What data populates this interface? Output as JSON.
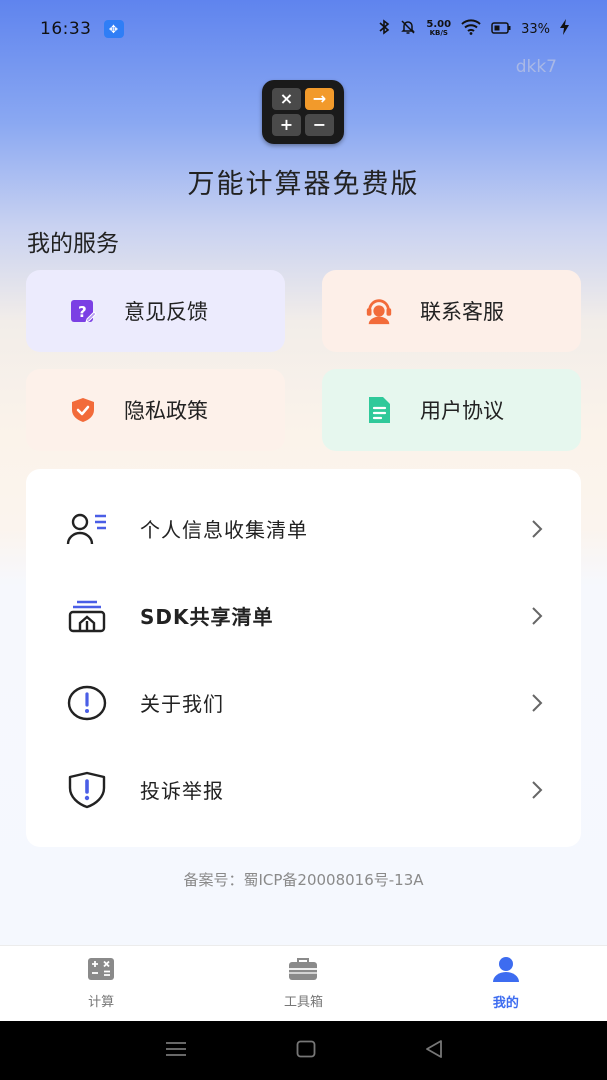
{
  "status_bar": {
    "time": "16:33",
    "speed_value": "5.00",
    "speed_unit": "KB/S",
    "battery": "33%"
  },
  "corner_tag": "dkk7",
  "app": {
    "title": "万能计算器免费版",
    "logo_keys": [
      "×",
      "→",
      "+",
      "−"
    ]
  },
  "services": {
    "title": "我的服务",
    "items": [
      {
        "label": "意见反馈",
        "icon": "feedback-icon",
        "color": "#7b3fe4"
      },
      {
        "label": "联系客服",
        "icon": "customer-service-icon",
        "color": "#f26b3a"
      },
      {
        "label": "隐私政策",
        "icon": "shield-check-icon",
        "color": "#f26b3a"
      },
      {
        "label": "用户协议",
        "icon": "document-icon",
        "color": "#2fc99a"
      }
    ]
  },
  "list": {
    "items": [
      {
        "label": "个人信息收集清单",
        "icon": "person-list-icon"
      },
      {
        "label": "SDK共享清单",
        "icon": "sdk-share-icon"
      },
      {
        "label": "关于我们",
        "icon": "info-circle-icon"
      },
      {
        "label": "投诉举报",
        "icon": "report-shield-icon"
      }
    ]
  },
  "icp": "备案号：蜀ICP备20008016号-13A",
  "tabs": [
    {
      "label": "计算",
      "icon": "calculator-icon",
      "active": false
    },
    {
      "label": "工具箱",
      "icon": "toolbox-icon",
      "active": false
    },
    {
      "label": "我的",
      "icon": "user-icon",
      "active": true
    }
  ],
  "colors": {
    "accent": "#3d6cf0",
    "panel_bg": "#ffffff"
  }
}
